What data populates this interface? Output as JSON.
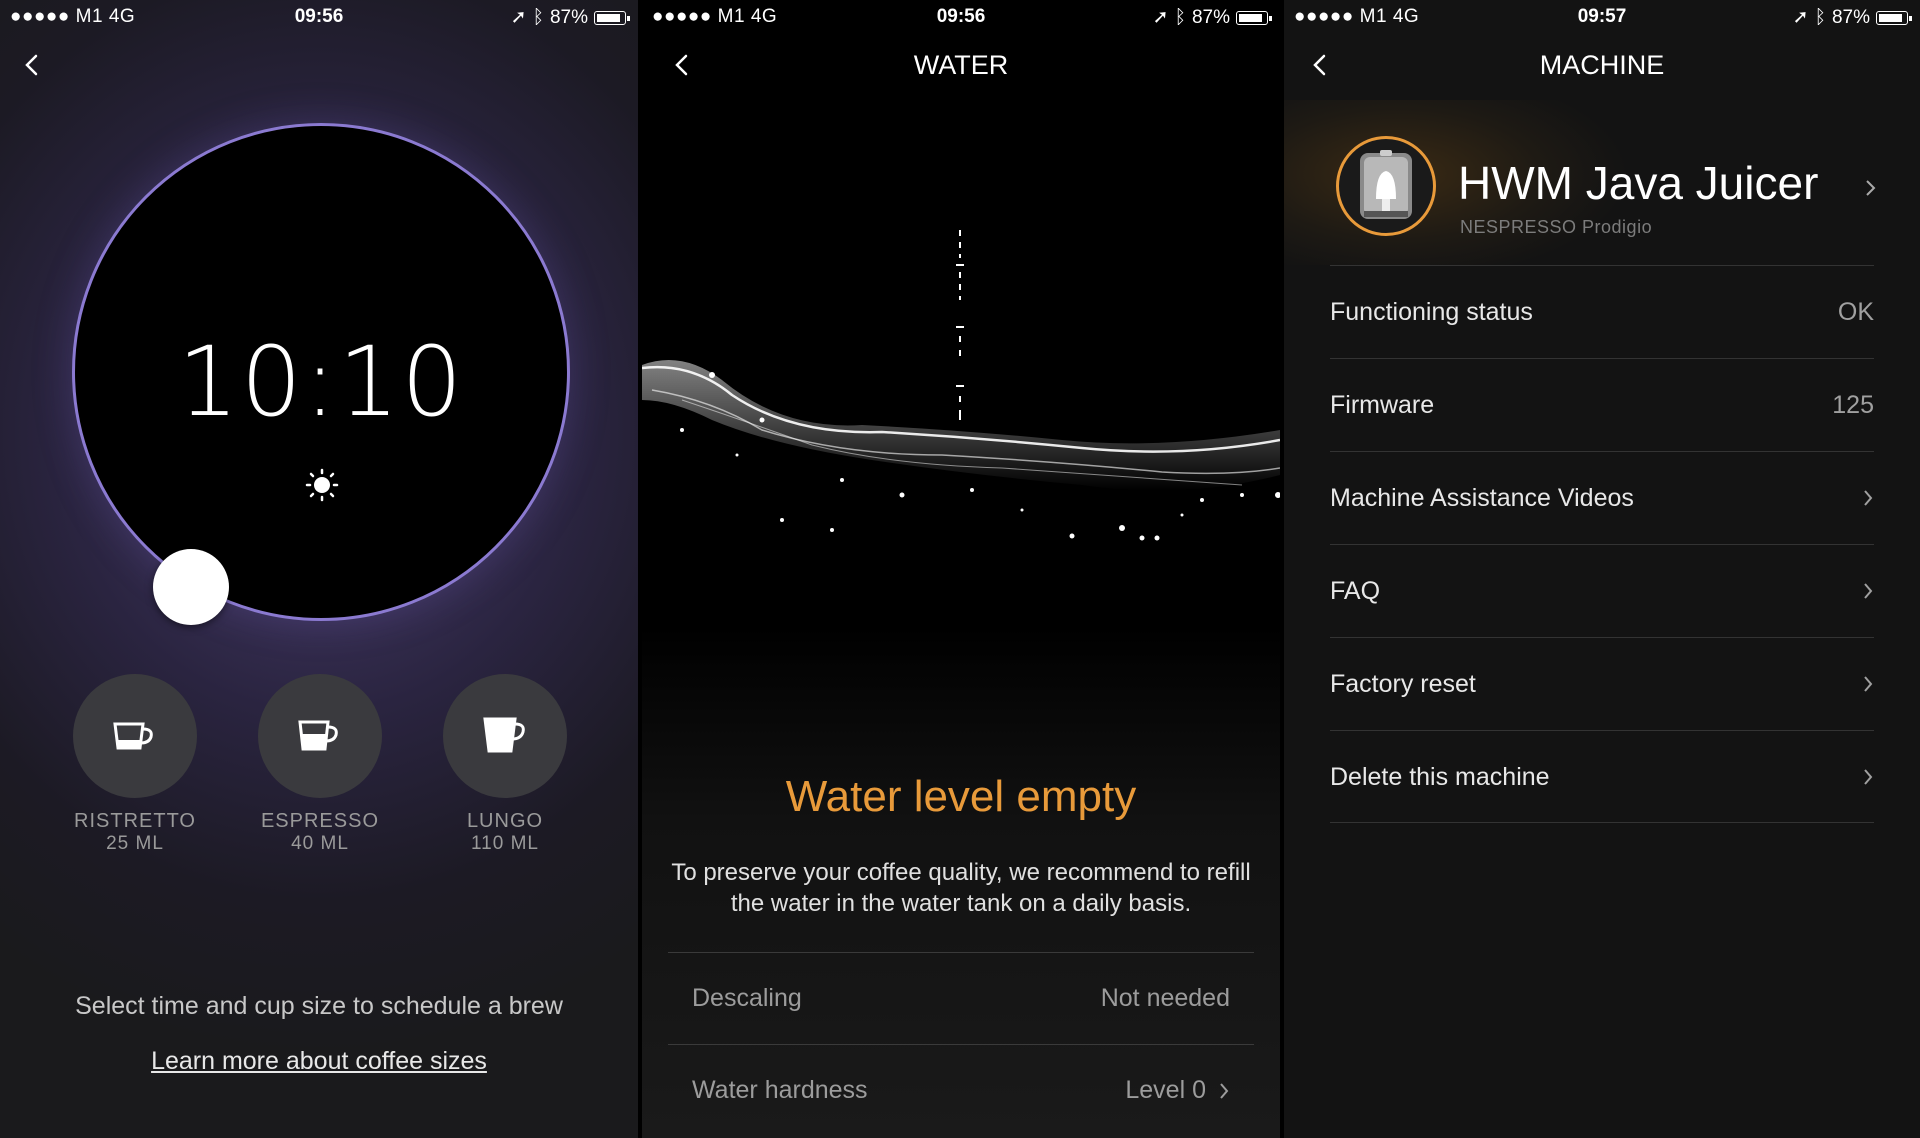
{
  "status": {
    "s1": {
      "carrier": "●●●●● M1   4G",
      "time": "09:56",
      "battery": "87%"
    },
    "s2": {
      "carrier": "●●●●● M1   4G",
      "time": "09:56",
      "battery": "87%"
    },
    "s3": {
      "carrier": "●●●●● M1   4G",
      "time": "09:57",
      "battery": "87%"
    }
  },
  "brew": {
    "time": "10:10",
    "cups": [
      {
        "name": "RISTRETTO",
        "volume": "25 ML"
      },
      {
        "name": "ESPRESSO",
        "volume": "40 ML"
      },
      {
        "name": "LUNGO",
        "volume": "110 ML"
      }
    ],
    "hint": "Select time and cup size to schedule a brew",
    "learn_link": "Learn more about coffee sizes"
  },
  "water": {
    "nav_title": "WATER",
    "title": "Water level empty",
    "description": "To preserve your coffee quality, we recommend to refill the water in the water tank on a daily basis.",
    "rows": [
      {
        "label": "Descaling",
        "value": "Not needed"
      },
      {
        "label": "Water hardness",
        "value": "Level 0"
      }
    ]
  },
  "machine": {
    "nav_title": "MACHINE",
    "name": "HWM Java Juicer",
    "model": "NESPRESSO Prodigio",
    "rows": [
      {
        "label": "Functioning status",
        "value": "OK"
      },
      {
        "label": "Firmware",
        "value": "125"
      },
      {
        "label": "Machine Assistance Videos",
        "value": ""
      },
      {
        "label": "FAQ",
        "value": ""
      },
      {
        "label": "Factory reset",
        "value": ""
      },
      {
        "label": "Delete this machine",
        "value": ""
      }
    ]
  },
  "colors": {
    "accent": "#e89a3a",
    "dial_ring": "#8b7ad1"
  }
}
